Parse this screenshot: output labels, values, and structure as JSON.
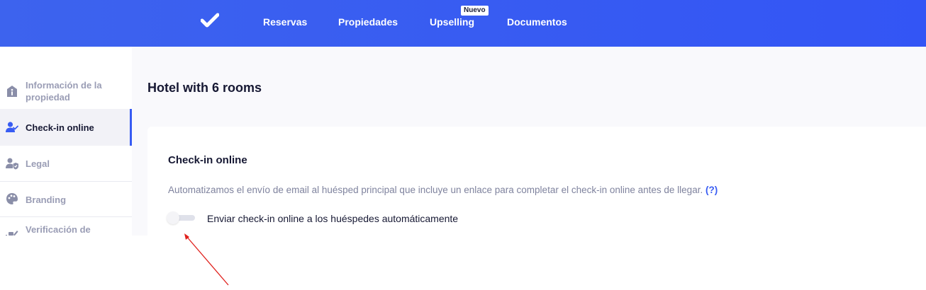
{
  "header": {
    "nav": [
      {
        "label": "Reservas"
      },
      {
        "label": "Propiedades"
      },
      {
        "label": "Upselling",
        "badge": "Nuevo"
      },
      {
        "label": "Documentos"
      }
    ]
  },
  "sidebar": {
    "items": [
      {
        "label": "Información de la propiedad",
        "icon": "info-house-icon",
        "active": false
      },
      {
        "label": "Check-in online",
        "icon": "user-check-icon",
        "active": true
      },
      {
        "label": "Legal",
        "icon": "user-shield-icon",
        "active": false
      },
      {
        "label": "Branding",
        "icon": "palette-icon",
        "active": false
      },
      {
        "label": "Verificación de",
        "icon": "id-scan-icon",
        "active": false
      }
    ]
  },
  "main": {
    "title": "Hotel with 6 rooms",
    "card": {
      "title": "Check-in online",
      "description": "Automatizamos el envío de email al huésped principal que incluye un enlace para completar el check-in online antes de llegar.",
      "help_link": "(?)",
      "toggle": {
        "label": "Enviar check-in online a los huéspedes automáticamente",
        "checked": false
      }
    }
  },
  "colors": {
    "accent": "#385cf3",
    "topbar": "#3d63ee",
    "text_dark": "#161833",
    "text_muted": "#7f839e",
    "annotation": "#e0201c"
  }
}
